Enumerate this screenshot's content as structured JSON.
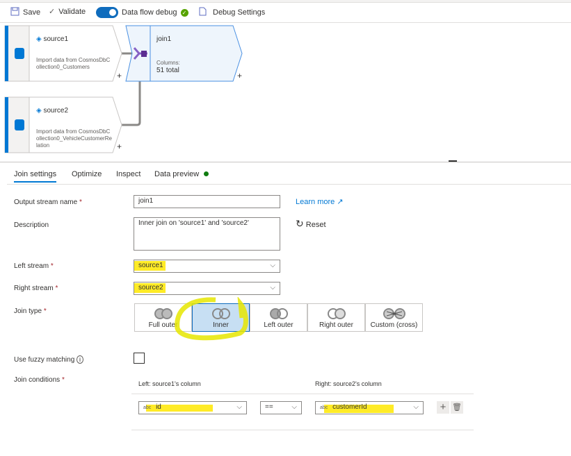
{
  "toolbar": {
    "save": "Save",
    "validate": "Validate",
    "debug": "Data flow debug",
    "debug_settings": "Debug Settings"
  },
  "canvas": {
    "source1": {
      "title": "source1",
      "desc": "Import data from CosmosDbCollection0_Customers"
    },
    "source2": {
      "title": "source2",
      "desc": "Import data from CosmosDbCollection0_VehicleCustomerRelation"
    },
    "join1": {
      "title": "join1",
      "columns_label": "Columns:",
      "columns_value": "51 total"
    },
    "plus": "+"
  },
  "tabs": [
    {
      "label": "Join settings"
    },
    {
      "label": "Optimize"
    },
    {
      "label": "Inspect"
    },
    {
      "label": "Data preview"
    }
  ],
  "form": {
    "output_stream_label": "Output stream name",
    "output_stream_value": "join1",
    "learn_more": "Learn more",
    "description_label": "Description",
    "description_value": "Inner join on 'source1' and 'source2'",
    "reset": "Reset",
    "left_stream_label": "Left stream",
    "left_stream_value": "source1",
    "right_stream_label": "Right stream",
    "right_stream_value": "source2",
    "join_type_label": "Join type",
    "join_types": [
      "Full outer",
      "Inner",
      "Left outer",
      "Right outer",
      "Custom (cross)"
    ],
    "selected_join_type": "Inner",
    "fuzzy_label": "Use fuzzy matching",
    "conditions_label": "Join conditions",
    "left_col_header": "Left: source1's column",
    "right_col_header": "Right: source2's column",
    "type_badge": "abc",
    "left_col_value": "id",
    "operator": "==",
    "right_col_value": "customerId",
    "required": "*"
  },
  "colors": {
    "accent": "#0078d4",
    "highlight": "#ffe800",
    "success": "#57a300"
  }
}
